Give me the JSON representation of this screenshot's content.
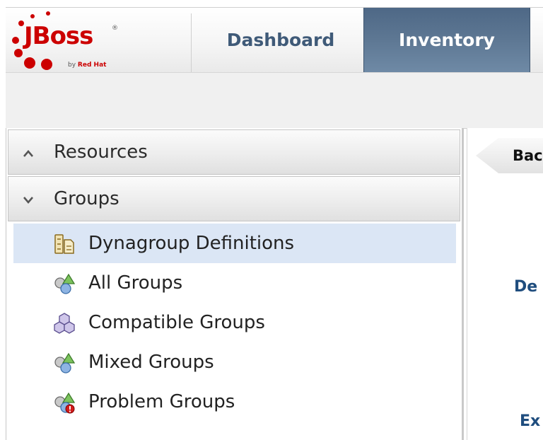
{
  "header": {
    "logo": {
      "brand": "JBoss",
      "registered": "®",
      "by_prefix": "by",
      "by_brand": "Red Hat"
    },
    "tabs": [
      {
        "label": "Dashboard",
        "active": false
      },
      {
        "label": "Inventory",
        "active": true
      }
    ]
  },
  "nav": {
    "sections": [
      {
        "label": "Resources",
        "expanded": false,
        "chevron": "chevron-up-icon"
      },
      {
        "label": "Groups",
        "expanded": true,
        "chevron": "chevron-down-icon"
      }
    ],
    "items": [
      {
        "label": "Dynagroup Definitions",
        "icon": "dynagroup-icon",
        "selected": true
      },
      {
        "label": "All Groups",
        "icon": "group-icon",
        "selected": false
      },
      {
        "label": "Compatible Groups",
        "icon": "compatible-group-icon",
        "selected": false
      },
      {
        "label": "Mixed Groups",
        "icon": "mixed-group-icon",
        "selected": false
      },
      {
        "label": "Problem Groups",
        "icon": "problem-group-icon",
        "selected": false
      }
    ]
  },
  "right": {
    "back_label": "Bac",
    "fragment_1": "De",
    "fragment_2": "Ex"
  },
  "colors": {
    "tab_active": "#5c7692",
    "tab_text": "#3f5a78",
    "selection": "#dbe6f5",
    "brand_red": "#cc0000"
  }
}
